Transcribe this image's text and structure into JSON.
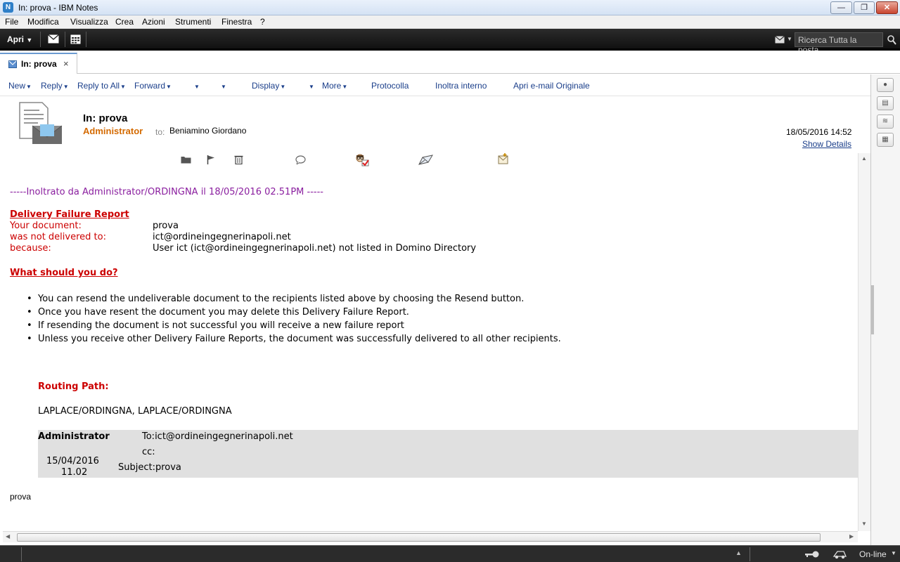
{
  "window": {
    "title": "In: prova - IBM Notes",
    "app_icon": "notes-icon"
  },
  "menu": [
    "File",
    "Modifica",
    "Visualizza",
    "Crea",
    "Azioni",
    "Strumenti",
    "Finestra",
    "?"
  ],
  "toolbar": {
    "apri_label": "Apri",
    "search_placeholder": "Ricerca Tutta la posta"
  },
  "tab": {
    "label": "In: prova",
    "close": "×"
  },
  "actions": {
    "new": "New",
    "reply": "Reply",
    "reply_all": "Reply to All",
    "forward": "Forward",
    "display": "Display",
    "more": "More",
    "protocolla": "Protocolla",
    "inoltra": "Inoltra interno",
    "apri_originale": "Apri e-mail Originale"
  },
  "message": {
    "subject": "In: prova",
    "from": "Administrator",
    "to_label": "to:",
    "to": "Beniamino Giordano",
    "date": "18/05/2016 14:52",
    "show_details": "Show Details"
  },
  "body": {
    "forward_line": "-----Inoltrato da Administrator/ORDINGNA il 18/05/2016 02.51PM -----",
    "report_title": "Delivery Failure Report",
    "fields": [
      {
        "label": "Your document:",
        "value": "prova"
      },
      {
        "label": "was not delivered to:",
        "value": "ict@ordineingegnerinapoli.net"
      },
      {
        "label": "because:",
        "value": "User ict (ict@ordineingegnerinapoli.net) not listed in Domino Directory"
      }
    ],
    "question": "What should you do?",
    "bullets": [
      "You can resend the undeliverable document to the recipients listed above by choosing the Resend button.",
      "Once you have resent the document you may delete this Delivery Failure Report.",
      "If resending the document is not successful you will receive a new failure report",
      "Unless you receive other Delivery Failure Reports, the document was successfully delivered to all other recipients."
    ],
    "routing_label": "Routing Path:",
    "routing_path": "LAPLACE/ORDINGNA, LAPLACE/ORDINGNA",
    "orig": {
      "sender": "Administrator",
      "to": "To:ict@ordineingegnerinapoli.net",
      "cc": "cc:",
      "date": "15/04/2016",
      "time": "11.02",
      "subject": "Subject:prova"
    },
    "footer_text": "prova"
  },
  "status": {
    "online": "On-line"
  }
}
